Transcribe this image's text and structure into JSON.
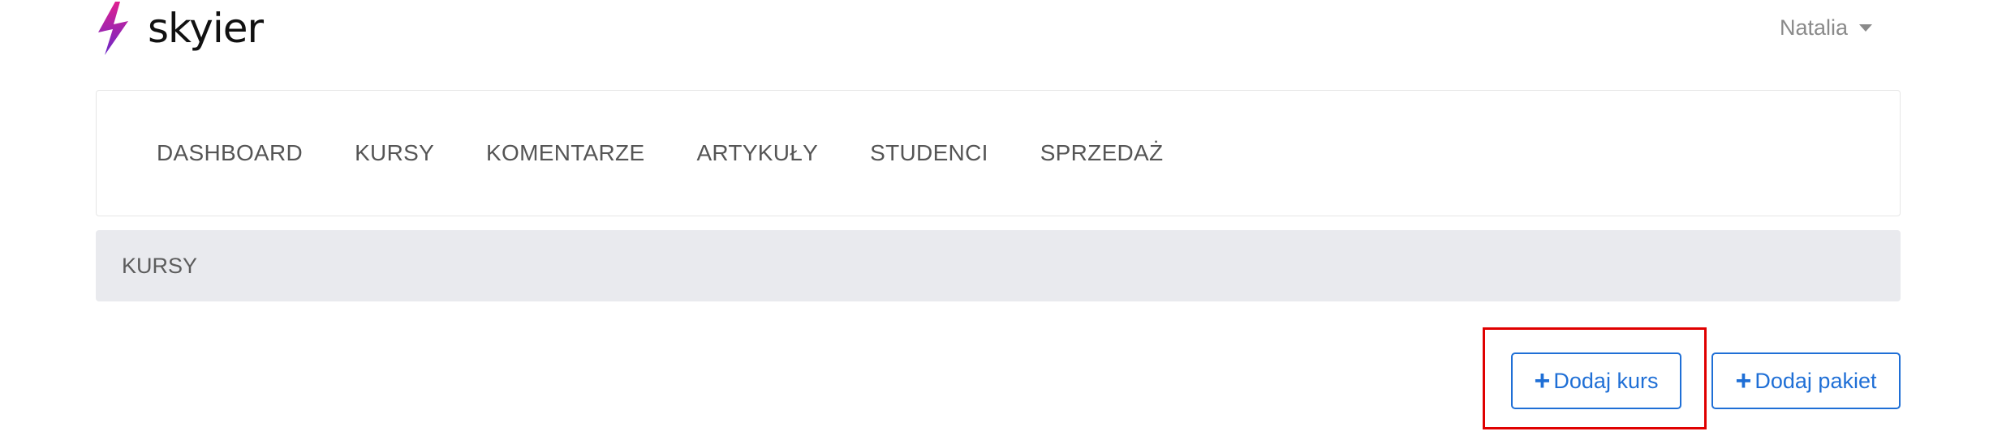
{
  "brand": {
    "name": "skyier",
    "logo_icon": "lightning-bolt-icon",
    "logo_colors": [
      "#e02090",
      "#6a28c8"
    ]
  },
  "user_menu": {
    "name": "Natalia",
    "icon": "caret-down-icon"
  },
  "nav": {
    "items": [
      {
        "label": "DASHBOARD"
      },
      {
        "label": "KURSY"
      },
      {
        "label": "KOMENTARZE"
      },
      {
        "label": "ARTYKUŁY"
      },
      {
        "label": "STUDENCI"
      },
      {
        "label": "SPRZEDAŻ"
      }
    ]
  },
  "breadcrumb": {
    "current": "KURSY"
  },
  "actions": {
    "add_course": {
      "icon": "plus-icon",
      "label": "Dodaj kurs"
    },
    "add_package": {
      "icon": "plus-icon",
      "label": "Dodaj pakiet"
    }
  },
  "colors": {
    "accent": "#1f6fd6",
    "highlight": "#e00000",
    "breadcrumb_bg": "#e9eaee"
  }
}
